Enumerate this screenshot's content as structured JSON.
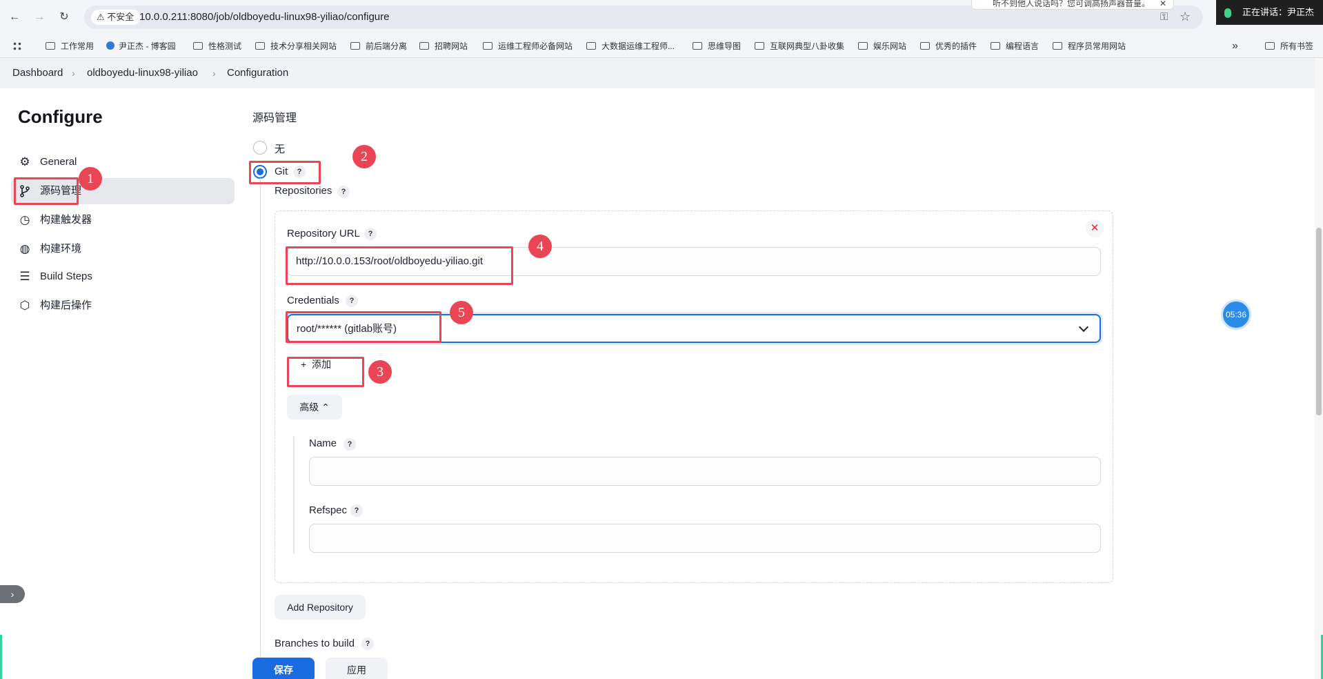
{
  "browser": {
    "security_label": "不安全",
    "url": "10.0.0.211:8080/job/oldboyedu-linux98-yiliao/configure",
    "popup_hint": "听不到他人说话吗？您可调高扬声器音量。",
    "popup_close": "✕",
    "speaking_label": "正在讲话：",
    "speaking_name": "尹正杰",
    "bookmarks": [
      "工作常用",
      "尹正杰 - 博客园",
      "性格测试",
      "技术分享相关网站",
      "前后端分离",
      "招聘网站",
      "运维工程师必备网站",
      "大数据运维工程师...",
      "思维导图",
      "互联网典型八卦收集",
      "娱乐网站",
      "优秀的插件",
      "编程语言",
      "程序员常用网站"
    ],
    "bookmarks_more": "»",
    "bookmarks_all": "所有书签"
  },
  "breadcrumb": {
    "items": [
      "Dashboard",
      "oldboyedu-linux98-yiliao",
      "Configuration"
    ],
    "separator": "›"
  },
  "sidebar": {
    "title": "Configure",
    "items": [
      {
        "label": "General",
        "icon": "gear-icon"
      },
      {
        "label": "源码管理",
        "icon": "branch-icon"
      },
      {
        "label": "构建触发器",
        "icon": "clock-icon"
      },
      {
        "label": "构建环境",
        "icon": "globe-icon"
      },
      {
        "label": "Build Steps",
        "icon": "list-icon"
      },
      {
        "label": "构建后操作",
        "icon": "package-icon"
      }
    ]
  },
  "scm": {
    "section_title": "源码管理",
    "option_none": "无",
    "option_git": "Git",
    "help": "?",
    "repositories_label": "Repositories",
    "repository_url_label": "Repository URL",
    "repository_url_value": "http://10.0.0.153/root/oldboyedu-yiliao.git",
    "credentials_label": "Credentials",
    "credentials_value": "root/****** (gitlab账号)",
    "add_button": "添加",
    "advanced_button": "高级",
    "name_label": "Name",
    "name_value": "",
    "refspec_label": "Refspec",
    "refspec_value": "",
    "add_repository_button": "Add Repository",
    "branches_label": "Branches to build"
  },
  "actions": {
    "save": "保存",
    "apply": "应用"
  },
  "annotations": [
    "1",
    "2",
    "3",
    "4",
    "5"
  ],
  "overlays": {
    "timer": "05:36"
  },
  "colors": {
    "accent": "#1a6be0",
    "annotation": "#ea4554",
    "delete": "#e5273d"
  }
}
